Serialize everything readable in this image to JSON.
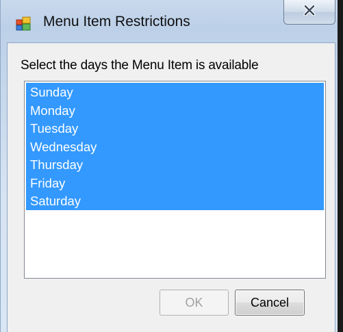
{
  "window": {
    "title": "Menu Item Restrictions",
    "icons": {
      "app": "form-window-icon",
      "close": "close-icon"
    }
  },
  "prompt": "Select the days the Menu Item is available",
  "days": {
    "items": [
      "Sunday",
      "Monday",
      "Tuesday",
      "Wednesday",
      "Thursday",
      "Friday",
      "Saturday"
    ],
    "selected": [
      "Sunday",
      "Monday",
      "Tuesday",
      "Wednesday",
      "Thursday",
      "Friday",
      "Saturday"
    ]
  },
  "buttons": {
    "ok_label": "OK",
    "ok_enabled": false,
    "cancel_label": "Cancel"
  },
  "colors": {
    "selection": "#3399ff",
    "selection_text": "#ffffff",
    "client_bg": "#f0f0f0",
    "disabled_text": "#a0a0a0"
  }
}
